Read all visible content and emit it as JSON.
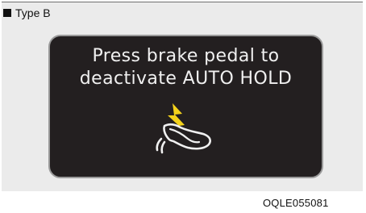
{
  "caption": {
    "label": "Type B"
  },
  "display": {
    "line1": "Press brake pedal to",
    "line2": "deactivate AUTO HOLD",
    "icon": "foot-on-brake-pedal-icon",
    "arrow_icon": "yellow-arrow-icon",
    "colors": {
      "screen": "#231f20",
      "text": "#f0f0f0",
      "arrow": "#f4d21b"
    }
  },
  "figure_code": "OQLE055081"
}
